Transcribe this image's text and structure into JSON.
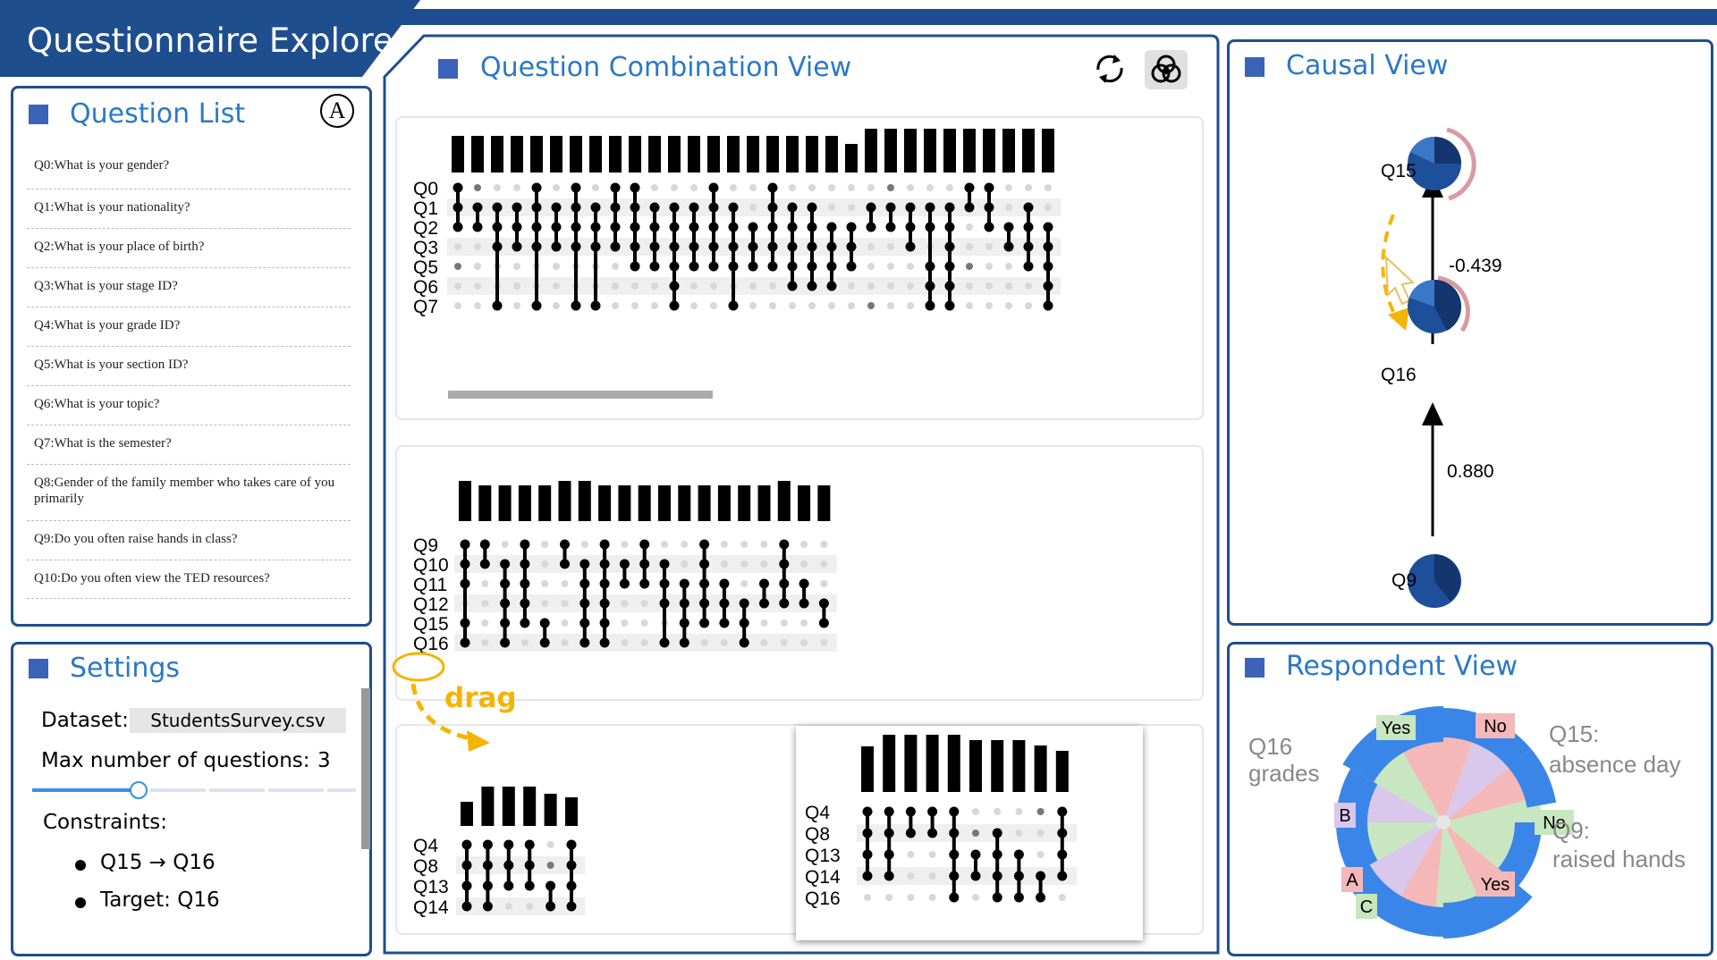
{
  "app": {
    "title": "Questionnaire Explorer"
  },
  "question_list": {
    "title": "Question List",
    "badge": "A",
    "items": [
      "Q0:What is your gender?",
      "Q1:What is your nationality?",
      "Q2:What is your place of birth?",
      "Q3:What is your stage ID?",
      "Q4:What is your grade ID?",
      "Q5:What is your section ID?",
      "Q6:What is your topic?",
      "Q7:What is the semester?",
      "Q8:Gender of the family member who takes care of you primarily",
      "Q9:Do you often raise hands in class?",
      "Q10:Do you often view the TED resources?"
    ]
  },
  "settings": {
    "title": "Settings",
    "dataset_label": "Dataset:",
    "dataset_value": "StudentsSurvey.csv",
    "max_label": "Max number of questions:",
    "max_value": "3",
    "slider_fraction": 0.33,
    "constraints_label": "Constraints:",
    "constraints": [
      "Q15 → Q16",
      "Target:  Q16"
    ]
  },
  "combination_view": {
    "title": "Question Combination View",
    "icons": [
      "refresh-icon",
      "venn-icon"
    ],
    "drag_label": "drag",
    "panel1_rows": [
      "Q0",
      "Q1",
      "Q2",
      "Q3",
      "Q5",
      "Q6",
      "Q7"
    ],
    "panel2_rows": [
      "Q9",
      "Q10",
      "Q11",
      "Q12",
      "Q15",
      "Q16"
    ],
    "panel3_rows": [
      "Q4",
      "Q8",
      "Q13",
      "Q14"
    ],
    "panel4_rows": [
      "Q4",
      "Q8",
      "Q13",
      "Q14",
      "Q16"
    ]
  },
  "causal_view": {
    "title": "Causal View",
    "nodes": [
      "Q15",
      "Q16",
      "Q9"
    ],
    "edges": [
      {
        "from": "Q16",
        "to": "Q15",
        "weight": "-0.439"
      },
      {
        "from": "Q9",
        "to": "Q16",
        "weight": "0.880"
      }
    ]
  },
  "respondent_view": {
    "title": "Respondent View",
    "q15_label": "Q15:",
    "q15_sub": "absence day",
    "q16_label": "Q16",
    "q16_sub": "grades",
    "q9_label": "Q9:",
    "q9_sub": "raised hands",
    "tags": [
      "Yes",
      "No",
      "No",
      "Yes",
      "B",
      "A",
      "C"
    ]
  },
  "colors": {
    "accent": "#2a78c8",
    "frame": "#1f4e8f",
    "drag": "#f5b400"
  }
}
